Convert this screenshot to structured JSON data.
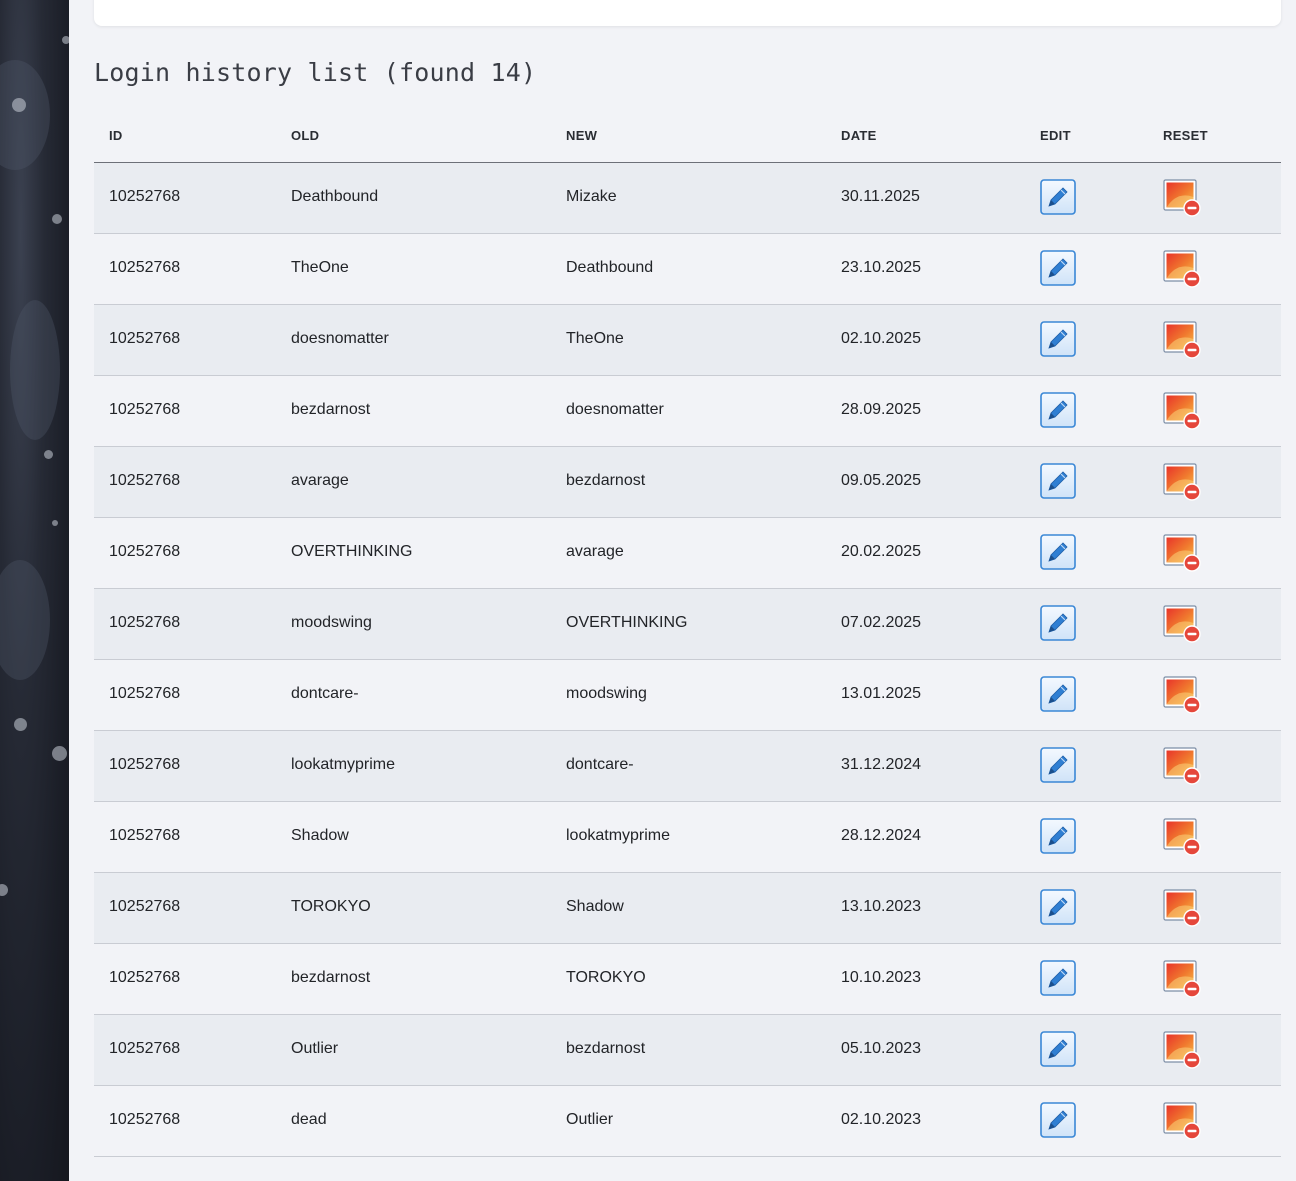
{
  "page": {
    "title": "Login history list (found 14)"
  },
  "table": {
    "columns": {
      "id": "ID",
      "old": "OLD",
      "new": "NEW",
      "date": "DATE",
      "edit": "EDIT",
      "reset": "RESET"
    },
    "rows": [
      {
        "id": "10252768",
        "old": "Deathbound",
        "new": "Mizake",
        "date": "30.11.2025"
      },
      {
        "id": "10252768",
        "old": "TheOne",
        "new": "Deathbound",
        "date": "23.10.2025"
      },
      {
        "id": "10252768",
        "old": "doesnomatter",
        "new": "TheOne",
        "date": "02.10.2025"
      },
      {
        "id": "10252768",
        "old": "bezdarnost",
        "new": "doesnomatter",
        "date": "28.09.2025"
      },
      {
        "id": "10252768",
        "old": "avarage",
        "new": "bezdarnost",
        "date": "09.05.2025"
      },
      {
        "id": "10252768",
        "old": "OVERTHINKING",
        "new": "avarage",
        "date": "20.02.2025"
      },
      {
        "id": "10252768",
        "old": "moodswing",
        "new": "OVERTHINKING",
        "date": "07.02.2025"
      },
      {
        "id": "10252768",
        "old": "dontcare-",
        "new": "moodswing",
        "date": "13.01.2025"
      },
      {
        "id": "10252768",
        "old": "lookatmyprime",
        "new": "dontcare-",
        "date": "31.12.2024"
      },
      {
        "id": "10252768",
        "old": "Shadow",
        "new": "lookatmyprime",
        "date": "28.12.2024"
      },
      {
        "id": "10252768",
        "old": "TOROKYO",
        "new": "Shadow",
        "date": "13.10.2023"
      },
      {
        "id": "10252768",
        "old": "bezdarnost",
        "new": "TOROKYO",
        "date": "10.10.2023"
      },
      {
        "id": "10252768",
        "old": "Outlier",
        "new": "bezdarnost",
        "date": "05.10.2023"
      },
      {
        "id": "10252768",
        "old": "dead",
        "new": "Outlier",
        "date": "02.10.2023"
      }
    ],
    "edit_icon": "pencil-edit-icon",
    "reset_icon": "image-remove-icon"
  },
  "colors": {
    "background": "#f2f3f7",
    "row_alt": "#e9ecf1",
    "edit_blue": "#2f7fd3",
    "reset_red": "#e5473b"
  }
}
